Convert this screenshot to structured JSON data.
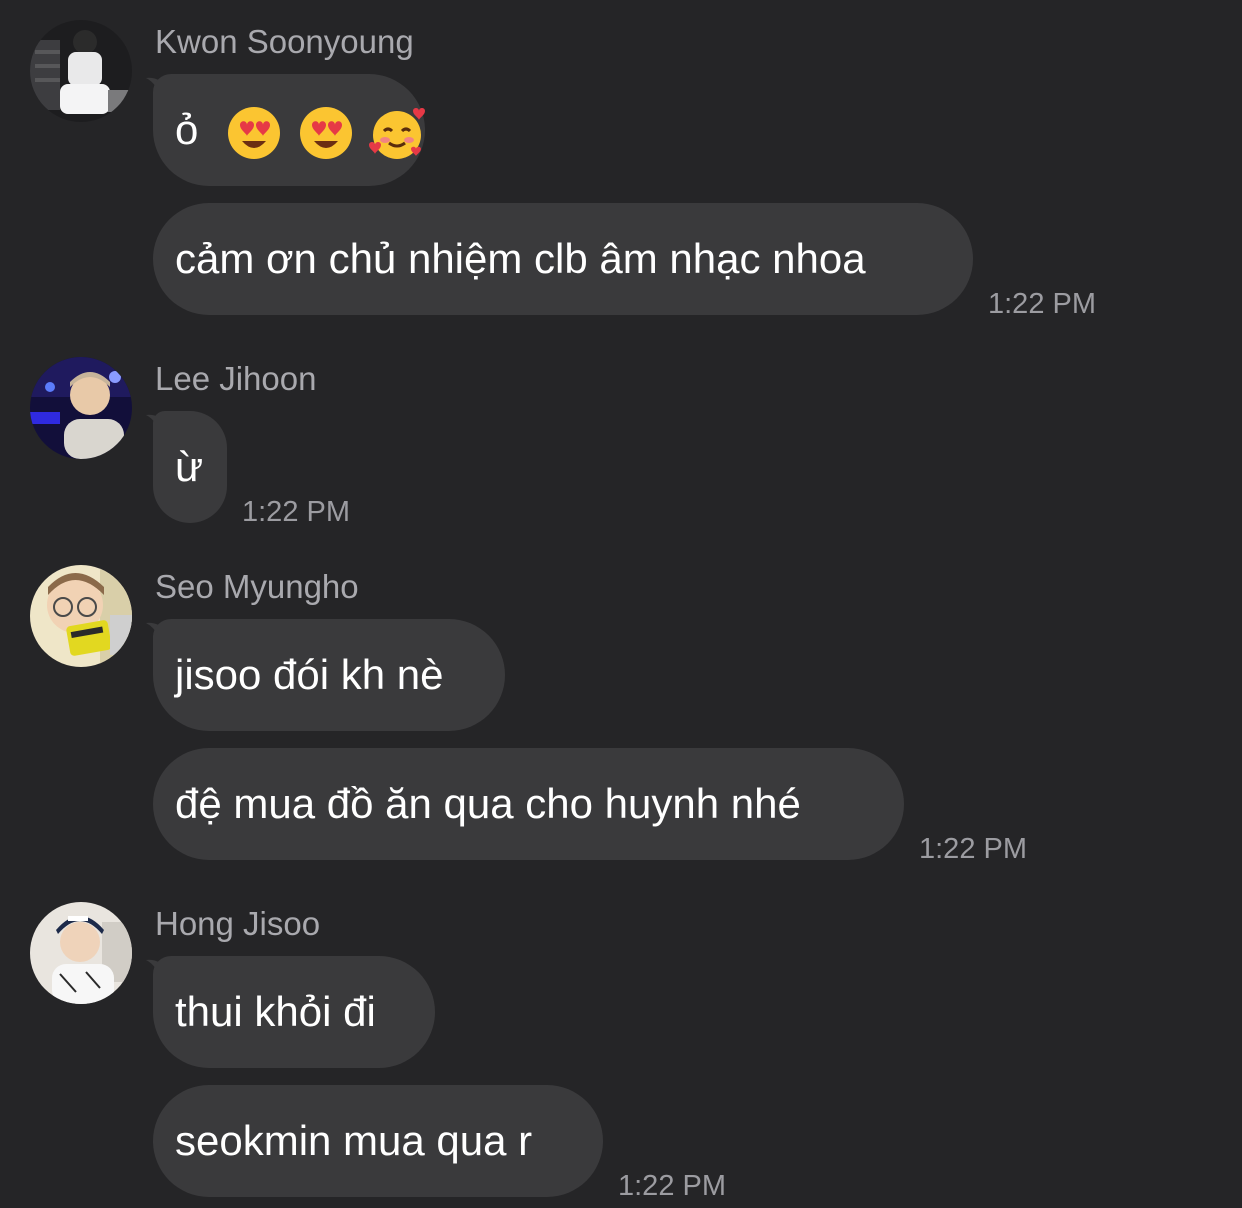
{
  "messages": [
    {
      "sender": "Kwon Soonyoung",
      "avatar_icon": "profile-photo-kwon-soonyoung",
      "bubbles": [
        {
          "text": "ỏ",
          "emoji": [
            "smiling-face-with-heart-eyes",
            "smiling-face-with-heart-eyes",
            "smiling-face-with-hearts"
          ]
        },
        {
          "text": "cảm ơn chủ nhiệm clb âm nhạc nhoa"
        }
      ],
      "time": "1:22 PM"
    },
    {
      "sender": "Lee Jihoon",
      "avatar_icon": "profile-photo-lee-jihoon",
      "bubbles": [
        {
          "text": "ừ"
        }
      ],
      "time": "1:22 PM"
    },
    {
      "sender": "Seo Myungho",
      "avatar_icon": "profile-photo-seo-myungho",
      "bubbles": [
        {
          "text": "jisoo đói kh nè"
        },
        {
          "text": "đệ mua đồ ăn qua cho huynh nhé"
        }
      ],
      "time": "1:22 PM"
    },
    {
      "sender": "Hong Jisoo",
      "avatar_icon": "profile-photo-hong-jisoo",
      "bubbles": [
        {
          "text": "thui khỏi đi"
        },
        {
          "text": "seokmin mua qua r"
        }
      ],
      "time": "1:22 PM"
    }
  ],
  "colors": {
    "background": "#252527",
    "bubble": "#3a3a3c",
    "sender_text": "#a9a9ae",
    "timestamp_text": "#9c9ca1",
    "message_text": "#ffffff"
  }
}
